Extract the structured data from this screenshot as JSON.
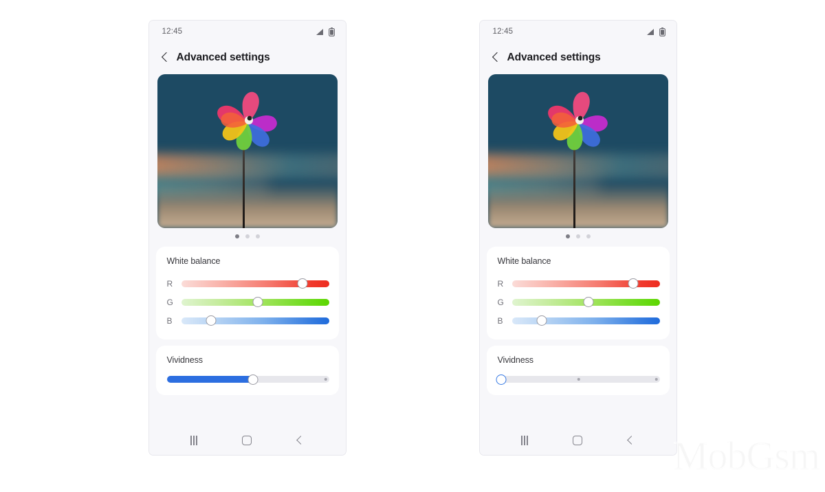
{
  "background_color": "#ffffff",
  "watermark": {
    "text": "MobGsm"
  },
  "phones": [
    {
      "id": "left",
      "status_bar": {
        "time": "12:45",
        "signal_icon": "signal-bars-icon",
        "battery_icon": "battery-icon"
      },
      "app_bar": {
        "back_icon": "back-chevron-icon",
        "title": "Advanced settings"
      },
      "preview": {
        "image_alt": "colorful pinwheel at sunset"
      },
      "page_dots": {
        "count": 3,
        "active_index": 0
      },
      "white_balance": {
        "title": "White balance",
        "sliders": [
          {
            "label": "R",
            "accent": "#ee2c1f",
            "value_pct": 82
          },
          {
            "label": "G",
            "accent": "#5cd600",
            "value_pct": 52
          },
          {
            "label": "B",
            "accent": "#1f6bdb",
            "value_pct": 20
          }
        ]
      },
      "vividness": {
        "title": "Vividness",
        "value_pct": 53,
        "fill_color": "#2c6ee0",
        "ticks_pct": [
          98
        ]
      },
      "nav_bar": {
        "recents_icon": "recents-icon",
        "home_icon": "home-icon",
        "back_icon": "back-icon"
      }
    },
    {
      "id": "right",
      "status_bar": {
        "time": "12:45",
        "signal_icon": "signal-bars-icon",
        "battery_icon": "battery-icon"
      },
      "app_bar": {
        "back_icon": "back-chevron-icon",
        "title": "Advanced settings"
      },
      "preview": {
        "image_alt": "colorful pinwheel at sunset"
      },
      "page_dots": {
        "count": 3,
        "active_index": 0
      },
      "white_balance": {
        "title": "White balance",
        "sliders": [
          {
            "label": "R",
            "accent": "#ee2c1f",
            "value_pct": 82
          },
          {
            "label": "G",
            "accent": "#5cd600",
            "value_pct": 52
          },
          {
            "label": "B",
            "accent": "#1f6bdb",
            "value_pct": 20
          }
        ]
      },
      "vividness": {
        "title": "Vividness",
        "value_pct": 1,
        "fill_color": "#2c6ee0",
        "ticks_pct": [
          50,
          98
        ]
      },
      "nav_bar": {
        "recents_icon": "recents-icon",
        "home_icon": "home-icon",
        "back_icon": "back-icon"
      }
    }
  ]
}
